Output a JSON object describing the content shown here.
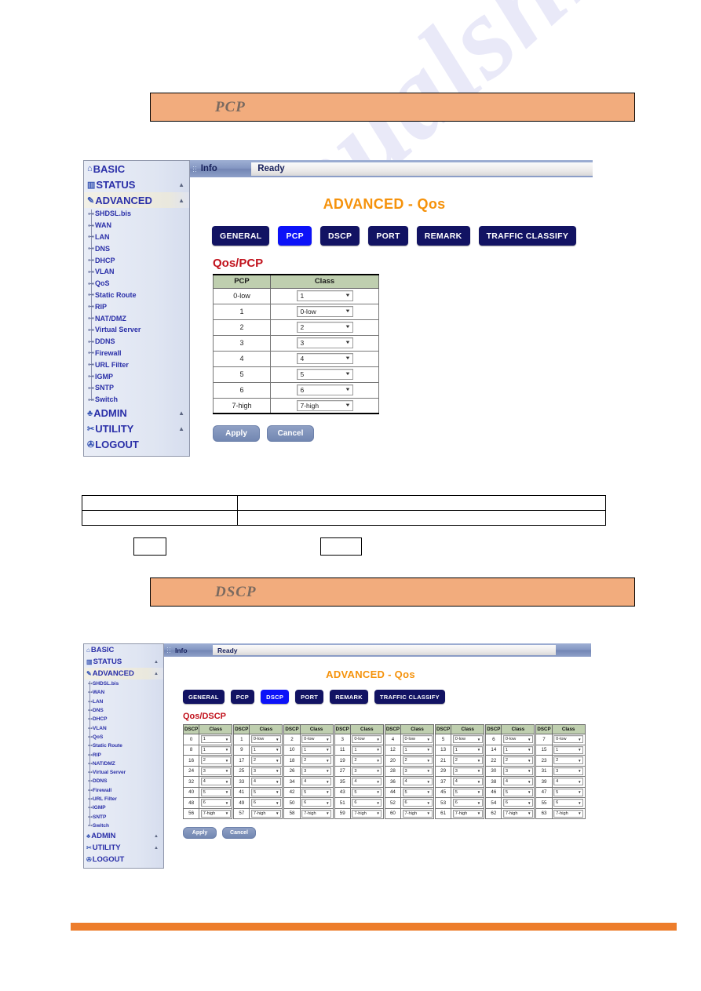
{
  "banners": {
    "pcp": "PCP",
    "dscp": "DSCP"
  },
  "sidebar": {
    "top_items": [
      {
        "label": "BASIC",
        "icon": "house-icon",
        "glyph": "⌂",
        "caret": "",
        "active": false
      },
      {
        "label": "STATUS",
        "icon": "chart-icon",
        "glyph": "▥",
        "caret": "▲",
        "active": false
      },
      {
        "label": "ADVANCED",
        "icon": "wrench-icon",
        "glyph": "✎",
        "caret": "▲",
        "active": true
      }
    ],
    "sub_items": [
      "SHDSL.bis",
      "WAN",
      "LAN",
      "DNS",
      "DHCP",
      "VLAN",
      "QoS",
      "Static Route",
      "RIP",
      "NAT/DMZ",
      "Virtual Server",
      "DDNS",
      "Firewall",
      "URL Filter",
      "IGMP",
      "SNTP",
      "Switch"
    ],
    "bottom_items": [
      {
        "label": "ADMIN",
        "icon": "people-icon",
        "glyph": "♣",
        "caret": "▲"
      },
      {
        "label": "UTILITY",
        "icon": "tools-icon",
        "glyph": "✂",
        "caret": "▲"
      },
      {
        "label": "LOGOUT",
        "icon": "exit-icon",
        "glyph": "✇",
        "caret": ""
      }
    ],
    "sub_tick": "⊶"
  },
  "infobar": {
    "label": "Info",
    "status": "Ready"
  },
  "page": {
    "title": "ADVANCED - Qos"
  },
  "tabs": [
    {
      "label": "GENERAL",
      "active_pcp": false,
      "active_dscp": false
    },
    {
      "label": "PCP",
      "active_pcp": true,
      "active_dscp": false
    },
    {
      "label": "DSCP",
      "active_pcp": false,
      "active_dscp": true
    },
    {
      "label": "PORT",
      "active_pcp": false,
      "active_dscp": false
    },
    {
      "label": "REMARK",
      "active_pcp": false,
      "active_dscp": false
    },
    {
      "label": "TRAFFIC CLASSIFY",
      "active_pcp": false,
      "active_dscp": false
    }
  ],
  "pcp_panel": {
    "section_title": "Qos/PCP",
    "columns": [
      "PCP",
      "Class"
    ],
    "rows": [
      {
        "pcp": "0-low",
        "class": "1"
      },
      {
        "pcp": "1",
        "class": "0-low"
      },
      {
        "pcp": "2",
        "class": "2"
      },
      {
        "pcp": "3",
        "class": "3"
      },
      {
        "pcp": "4",
        "class": "4"
      },
      {
        "pcp": "5",
        "class": "5"
      },
      {
        "pcp": "6",
        "class": "6"
      },
      {
        "pcp": "7-high",
        "class": "7-high"
      }
    ]
  },
  "dscp_panel": {
    "section_title": "Qos/DSCP",
    "columns": [
      "DSCP",
      "Class"
    ],
    "groups": [
      {
        "rows": [
          {
            "dscp": "0",
            "class": "1"
          },
          {
            "dscp": "8",
            "class": "1"
          },
          {
            "dscp": "16",
            "class": "2"
          },
          {
            "dscp": "24",
            "class": "3"
          },
          {
            "dscp": "32",
            "class": "4"
          },
          {
            "dscp": "40",
            "class": "5"
          },
          {
            "dscp": "48",
            "class": "6"
          },
          {
            "dscp": "56",
            "class": "7-high"
          }
        ]
      },
      {
        "rows": [
          {
            "dscp": "1",
            "class": "0-low"
          },
          {
            "dscp": "9",
            "class": "1"
          },
          {
            "dscp": "17",
            "class": "2"
          },
          {
            "dscp": "25",
            "class": "3"
          },
          {
            "dscp": "33",
            "class": "4"
          },
          {
            "dscp": "41",
            "class": "5"
          },
          {
            "dscp": "49",
            "class": "6"
          },
          {
            "dscp": "57",
            "class": "7-high"
          }
        ]
      },
      {
        "rows": [
          {
            "dscp": "2",
            "class": "0-low"
          },
          {
            "dscp": "10",
            "class": "1"
          },
          {
            "dscp": "18",
            "class": "2"
          },
          {
            "dscp": "26",
            "class": "3"
          },
          {
            "dscp": "34",
            "class": "4"
          },
          {
            "dscp": "42",
            "class": "5"
          },
          {
            "dscp": "50",
            "class": "6"
          },
          {
            "dscp": "58",
            "class": "7-high"
          }
        ]
      },
      {
        "rows": [
          {
            "dscp": "3",
            "class": "0-low"
          },
          {
            "dscp": "11",
            "class": "1"
          },
          {
            "dscp": "19",
            "class": "2"
          },
          {
            "dscp": "27",
            "class": "3"
          },
          {
            "dscp": "35",
            "class": "4"
          },
          {
            "dscp": "43",
            "class": "5"
          },
          {
            "dscp": "51",
            "class": "6"
          },
          {
            "dscp": "59",
            "class": "7-high"
          }
        ]
      },
      {
        "rows": [
          {
            "dscp": "4",
            "class": "0-low"
          },
          {
            "dscp": "12",
            "class": "1"
          },
          {
            "dscp": "20",
            "class": "2"
          },
          {
            "dscp": "28",
            "class": "3"
          },
          {
            "dscp": "36",
            "class": "4"
          },
          {
            "dscp": "44",
            "class": "5"
          },
          {
            "dscp": "52",
            "class": "6"
          },
          {
            "dscp": "60",
            "class": "7-high"
          }
        ]
      },
      {
        "rows": [
          {
            "dscp": "5",
            "class": "0-low"
          },
          {
            "dscp": "13",
            "class": "1"
          },
          {
            "dscp": "21",
            "class": "2"
          },
          {
            "dscp": "29",
            "class": "3"
          },
          {
            "dscp": "37",
            "class": "4"
          },
          {
            "dscp": "45",
            "class": "5"
          },
          {
            "dscp": "53",
            "class": "6"
          },
          {
            "dscp": "61",
            "class": "7-high"
          }
        ]
      },
      {
        "rows": [
          {
            "dscp": "6",
            "class": "0-low"
          },
          {
            "dscp": "14",
            "class": "1"
          },
          {
            "dscp": "22",
            "class": "2"
          },
          {
            "dscp": "30",
            "class": "3"
          },
          {
            "dscp": "38",
            "class": "4"
          },
          {
            "dscp": "46",
            "class": "5"
          },
          {
            "dscp": "54",
            "class": "6"
          },
          {
            "dscp": "62",
            "class": "7-high"
          }
        ]
      },
      {
        "rows": [
          {
            "dscp": "7",
            "class": "0-low"
          },
          {
            "dscp": "15",
            "class": "1"
          },
          {
            "dscp": "23",
            "class": "2"
          },
          {
            "dscp": "31",
            "class": "3"
          },
          {
            "dscp": "39",
            "class": "4"
          },
          {
            "dscp": "47",
            "class": "5"
          },
          {
            "dscp": "55",
            "class": "6"
          },
          {
            "dscp": "63",
            "class": "7-high"
          }
        ]
      }
    ]
  },
  "buttons": {
    "apply": "Apply",
    "cancel": "Cancel"
  },
  "watermark": "manualshive.com",
  "colors": {
    "banner": "#F2AC7D",
    "tab": "#121363",
    "tab_active": "#0C12F8",
    "title": "#F5920B",
    "section_title": "#C1121C",
    "table_header": "#BFCFAF",
    "footer": "#ED7D2B",
    "sidebar_text": "#2A2FA8"
  },
  "icons": {
    "select_arrow": "▼"
  }
}
